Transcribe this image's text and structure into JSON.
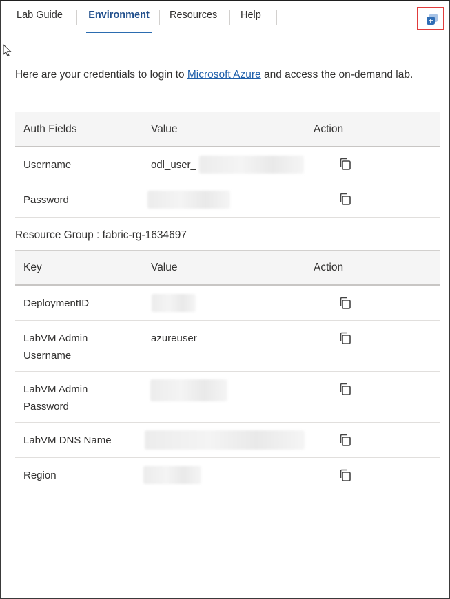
{
  "tabs": [
    {
      "label": "Lab Guide",
      "active": false
    },
    {
      "label": "Environment",
      "active": true
    },
    {
      "label": "Resources",
      "active": false
    },
    {
      "label": "Help",
      "active": false
    }
  ],
  "popout_icon": "popout-window-icon",
  "intro": {
    "before": "Here are your credentials to login to ",
    "link": "Microsoft Azure",
    "after": " and access the on-demand lab."
  },
  "auth_table": {
    "headers": [
      "Auth Fields",
      "Value",
      "Action"
    ],
    "rows": [
      {
        "field": "Username",
        "value": "odl_user_"
      },
      {
        "field": "Password",
        "value": ""
      }
    ]
  },
  "resource_group": {
    "title": "Resource Group : fabric-rg-1634697"
  },
  "rg_table": {
    "headers": [
      "Key",
      "Value",
      "Action"
    ],
    "rows": [
      {
        "field": "DeploymentID",
        "value": ""
      },
      {
        "field": "LabVM Admin Username",
        "value": "azureuser"
      },
      {
        "field": "LabVM Admin Password",
        "value": ""
      },
      {
        "field": "LabVM DNS Name",
        "value": ""
      },
      {
        "field": "Region",
        "value": ""
      }
    ]
  },
  "colors": {
    "accent": "#2b6cb0",
    "active_tab_text": "#1f4e8c",
    "link": "#1f5faa",
    "highlight_box": "#e03c3c",
    "popout_icon": "#2f6db5"
  }
}
